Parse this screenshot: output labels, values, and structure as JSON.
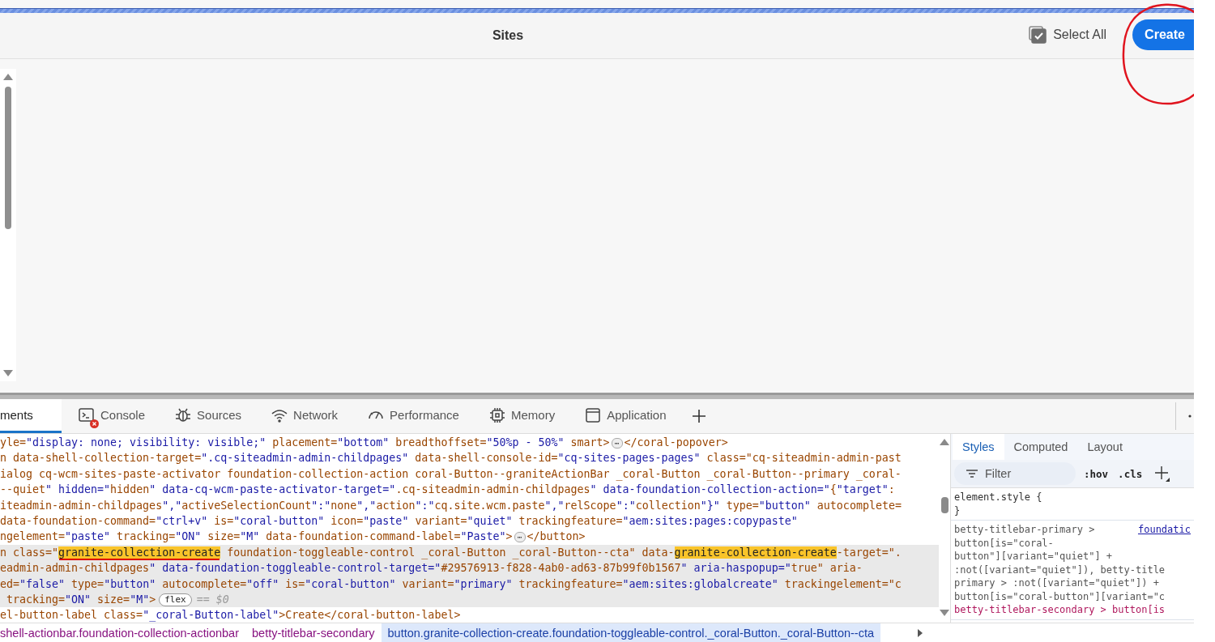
{
  "page": {
    "title": "Sites",
    "select_all": {
      "label": "Select All",
      "checked": true
    },
    "create_button": "Create"
  },
  "devtools": {
    "tabs": [
      {
        "label": "ments",
        "kind": "elements",
        "selected": true,
        "has_error": false
      },
      {
        "label": "Console",
        "kind": "console",
        "selected": false,
        "has_error": true
      },
      {
        "label": "Sources",
        "kind": "sources",
        "selected": false,
        "has_error": false
      },
      {
        "label": "Network",
        "kind": "network",
        "selected": false,
        "has_error": false
      },
      {
        "label": "Performance",
        "kind": "performance",
        "selected": false,
        "has_error": false
      },
      {
        "label": "Memory",
        "kind": "memory",
        "selected": false,
        "has_error": false
      },
      {
        "label": "Application",
        "kind": "application",
        "selected": false,
        "has_error": false
      }
    ],
    "lines": [
      {
        "selected": false,
        "segments": [
          {
            "kind": "code",
            "text": "yle=\"display: none; visibility: visible;\" placement=\"bottom\" breadthoffset=\"50%p - 50%\" smart>"
          },
          {
            "kind": "ellipsis",
            "text": "⋯"
          },
          {
            "kind": "code",
            "text": "</coral-popover>"
          }
        ]
      },
      {
        "selected": false,
        "segments": [
          {
            "kind": "code",
            "text": "n data-shell-collection-target=\".cq-siteadmin-admin-childpages\" data-shell-console-id=\"cq-sites-pages-pages\" class=\"cq-siteadmin-admin-past"
          }
        ]
      },
      {
        "selected": false,
        "segments": [
          {
            "kind": "code",
            "text": "ialog cq-wcm-sites-paste-activator foundation-collection-action coral-Button--graniteActionBar _coral-Button _coral-Button--primary _coral-"
          }
        ]
      },
      {
        "selected": false,
        "segments": [
          {
            "kind": "code",
            "text": "--quiet\" hidden=\"hidden\" data-cq-wcm-paste-activator-target=\".cq-siteadmin-admin-childpages\" data-foundation-collection-action=\"{\"target\":"
          }
        ]
      },
      {
        "selected": false,
        "segments": [
          {
            "kind": "code",
            "text": "iteadmin-admin-childpages\",\"activeSelectionCount\":\"none\",\"action\":\"cq.site.wcm.paste\",\"relScope\":\"collection\"}\" type=\"button\" autocomplete="
          }
        ]
      },
      {
        "selected": false,
        "segments": [
          {
            "kind": "code",
            "text": "data-foundation-command=\"ctrl+v\" is=\"coral-button\" icon=\"paste\" variant=\"quiet\" trackingfeature=\"aem:sites:pages:copypaste\""
          }
        ]
      },
      {
        "selected": false,
        "segments": [
          {
            "kind": "code",
            "text": "ngelement=\"paste\" tracking=\"ON\" size=\"M\" data-foundation-command-label=\"Paste\">"
          },
          {
            "kind": "ellipsis",
            "text": "⋯"
          },
          {
            "kind": "code",
            "text": "</button>"
          }
        ]
      },
      {
        "selected": true,
        "segments": [
          {
            "kind": "code",
            "text": "n class=\""
          },
          {
            "kind": "match",
            "text": "granite-collection-create",
            "underlined": true
          },
          {
            "kind": "code",
            "text": " foundation-toggleable-control _coral-Button _coral-Button--cta\" data-"
          },
          {
            "kind": "match",
            "text": "granite-collection-create",
            "underlined": false
          },
          {
            "kind": "code",
            "text": "-target=\"."
          }
        ]
      },
      {
        "selected": true,
        "segments": [
          {
            "kind": "code",
            "text": "eadmin-admin-childpages\" data-foundation-toggleable-control-target=\"#29576913-f828-4ab0-ad63-87b99f0b1567\" aria-haspopup=\"true\" aria-"
          }
        ]
      },
      {
        "selected": true,
        "segments": [
          {
            "kind": "code",
            "text": "ed=\"false\" type=\"button\" autocomplete=\"off\" is=\"coral-button\" variant=\"primary\" trackingfeature=\"aem:sites:globalcreate\" trackingelement=\"c"
          }
        ]
      },
      {
        "selected": true,
        "segments": [
          {
            "kind": "code",
            "text": " tracking=\"ON\" size=\"M\">"
          },
          {
            "kind": "badge",
            "text": "flex"
          },
          {
            "kind": "dim",
            "text": "== $0"
          }
        ]
      },
      {
        "selected": false,
        "segments": [
          {
            "kind": "code",
            "text": "el-button-label class=\"_coral-Button-label\">Create</coral-button-label>"
          }
        ]
      }
    ],
    "breadcrumbs": [
      {
        "text": "shell-actionbar.foundation-collection-actionbar",
        "selected": false
      },
      {
        "text": "betty-titlebar-secondary",
        "selected": false
      },
      {
        "text": "button.granite-collection-create.foundation-toggleable-control._coral-Button._coral-Button--cta",
        "selected": true
      }
    ],
    "styles": {
      "tabs": [
        {
          "label": "Styles",
          "selected": true
        },
        {
          "label": "Computed",
          "selected": false
        },
        {
          "label": "Layout",
          "selected": false
        }
      ],
      "filter": {
        "placeholder": "Filter"
      },
      "toggles": [
        ":hov",
        ".cls"
      ],
      "rules": [
        {
          "lines": [
            {
              "text": "element.style {"
            },
            {
              "text": "}"
            }
          ]
        },
        {
          "source": "foundatic",
          "lines": [
            {
              "text": "betty-titlebar-primary >",
              "matched": false
            },
            {
              "text": "button[is=\"coral-",
              "matched": false
            },
            {
              "text": "button\"][variant=\"quiet\"] +",
              "matched": false
            },
            {
              "text": ":not([variant=\"quiet\"]), betty-title",
              "matched": false
            },
            {
              "text": "primary > :not([variant=\"quiet\"]) +",
              "matched": false
            },
            {
              "text": "button[is=\"coral-button\"][variant=\"c",
              "matched": false
            },
            {
              "text": "betty-titlebar-secondary > button[is",
              "matched": true
            }
          ]
        }
      ]
    }
  }
}
